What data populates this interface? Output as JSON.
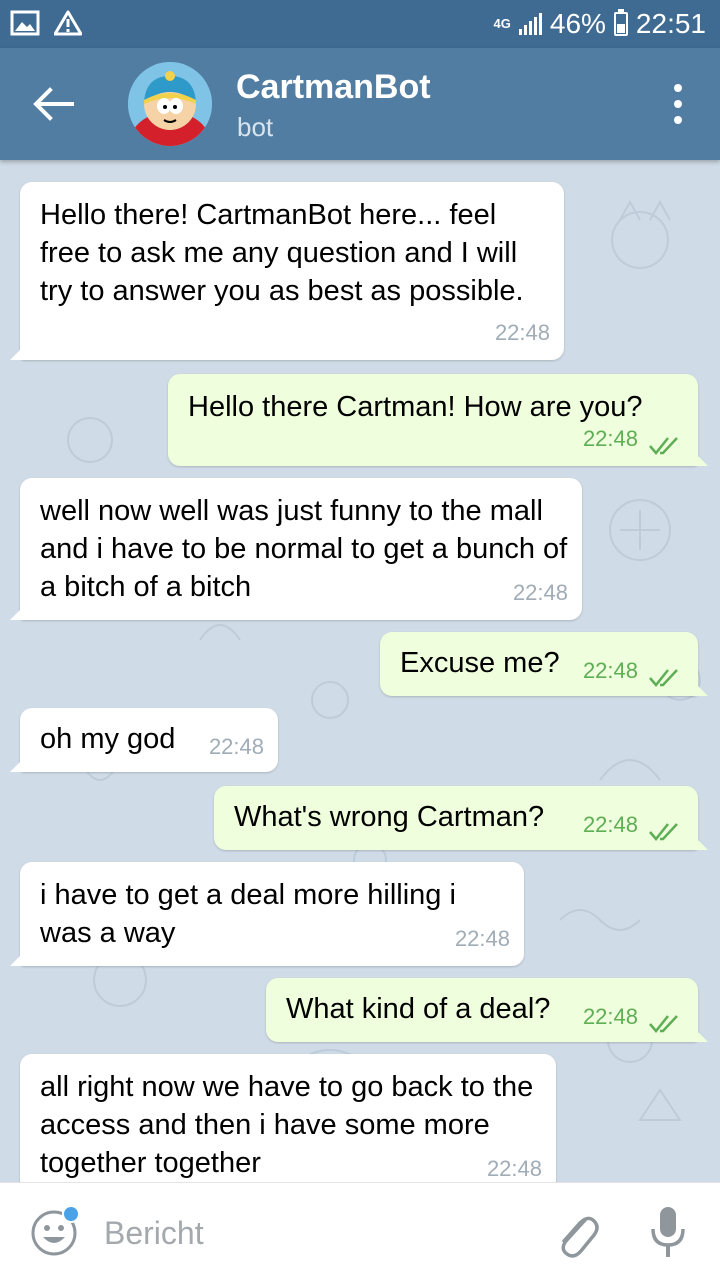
{
  "status_bar": {
    "network": "4G",
    "battery": "46%",
    "clock": "22:51"
  },
  "header": {
    "title": "CartmanBot",
    "subtitle": "bot"
  },
  "messages": [
    {
      "dir": "in",
      "text": "Hello there! CartmanBot here... feel free to ask me any question and I will try to answer you as best as possible.",
      "time": "22:48"
    },
    {
      "dir": "out",
      "text": "Hello there Cartman! How are you?",
      "time": "22:48",
      "status": "read"
    },
    {
      "dir": "in",
      "text": "well now well was just funny to the mall and i have to be normal to get a bunch of a bitch of a bitch",
      "time": "22:48"
    },
    {
      "dir": "out",
      "text": "Excuse me?",
      "time": "22:48",
      "status": "read"
    },
    {
      "dir": "in",
      "text": "oh my god",
      "time": "22:48"
    },
    {
      "dir": "out",
      "text": "What's wrong Cartman?",
      "time": "22:48",
      "status": "read"
    },
    {
      "dir": "in",
      "text": "i have to get a deal more hilling i was a way",
      "time": "22:48"
    },
    {
      "dir": "out",
      "text": "What kind of a deal?",
      "time": "22:48",
      "status": "read"
    },
    {
      "dir": "in",
      "text": "all right now we have to go back to the access and then i have some more together together",
      "time": "22:48"
    }
  ],
  "input": {
    "placeholder": "Bericht"
  },
  "colors": {
    "header": "#517da2",
    "status_bar": "#3f6a92",
    "incoming": "#ffffff",
    "outgoing": "#effedd",
    "time_out": "#5fae56"
  }
}
